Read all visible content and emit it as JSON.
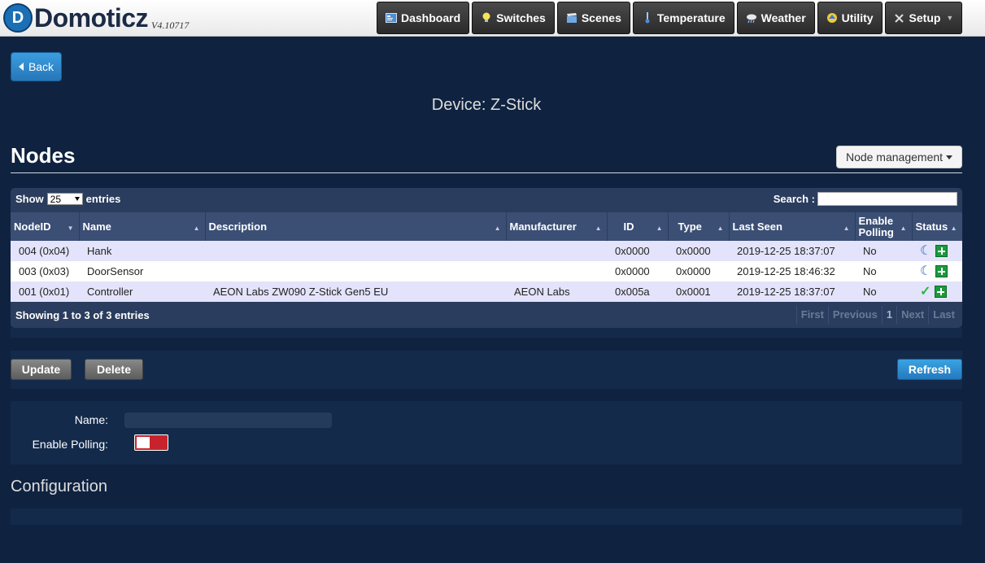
{
  "app": {
    "name": "Domoticz",
    "version": "V4.10717",
    "logo_letter": "D"
  },
  "nav": [
    {
      "label": "Dashboard",
      "icon": "dashboard-icon"
    },
    {
      "label": "Switches",
      "icon": "lightbulb-icon"
    },
    {
      "label": "Scenes",
      "icon": "clapperboard-icon"
    },
    {
      "label": "Temperature",
      "icon": "thermometer-icon"
    },
    {
      "label": "Weather",
      "icon": "cloud-rain-icon"
    },
    {
      "label": "Utility",
      "icon": "utility-icon"
    },
    {
      "label": "Setup",
      "icon": "wrench-icon"
    }
  ],
  "back_label": "Back",
  "device_title": "Device: Z-Stick",
  "nodes_heading": "Nodes",
  "node_management_label": "Node management",
  "table": {
    "show_label": "Show",
    "entries_value": "25",
    "entries_label": "entries",
    "search_label": "Search :",
    "search_value": "",
    "columns": [
      "NodeID",
      "Name",
      "Description",
      "Manufacturer",
      "ID",
      "Type",
      "Last Seen",
      "Enable Polling",
      "Status"
    ],
    "rows": [
      {
        "node_id": "004 (0x04)",
        "name": "Hank",
        "description": "",
        "manufacturer": "",
        "id": "0x0000",
        "type": "0x0000",
        "last_seen": "2019-12-25 18:37:07",
        "polling": "No",
        "status_icon": "moon-icon"
      },
      {
        "node_id": "003 (0x03)",
        "name": "DoorSensor",
        "description": "",
        "manufacturer": "",
        "id": "0x0000",
        "type": "0x0000",
        "last_seen": "2019-12-25 18:46:32",
        "polling": "No",
        "status_icon": "moon-icon"
      },
      {
        "node_id": "001 (0x01)",
        "name": "Controller",
        "description": "AEON Labs ZW090 Z-Stick Gen5 EU",
        "manufacturer": "AEON Labs",
        "id": "0x005a",
        "type": "0x0001",
        "last_seen": "2019-12-25 18:37:07",
        "polling": "No",
        "status_icon": "check-icon"
      }
    ],
    "info": "Showing 1 to 3 of 3 entries",
    "pager": {
      "first": "First",
      "previous": "Previous",
      "current": "1",
      "next": "Next",
      "last": "Last"
    }
  },
  "buttons": {
    "update": "Update",
    "delete": "Delete",
    "refresh": "Refresh"
  },
  "form": {
    "name_label": "Name:",
    "name_value": "",
    "polling_label": "Enable Polling:",
    "polling_enabled": false
  },
  "configuration_heading": "Configuration",
  "colors": {
    "background": "#0f2340",
    "accent_blue": "#2677b8",
    "toggle_off": "#c8232c",
    "row_odd": "#e3e3fb"
  }
}
